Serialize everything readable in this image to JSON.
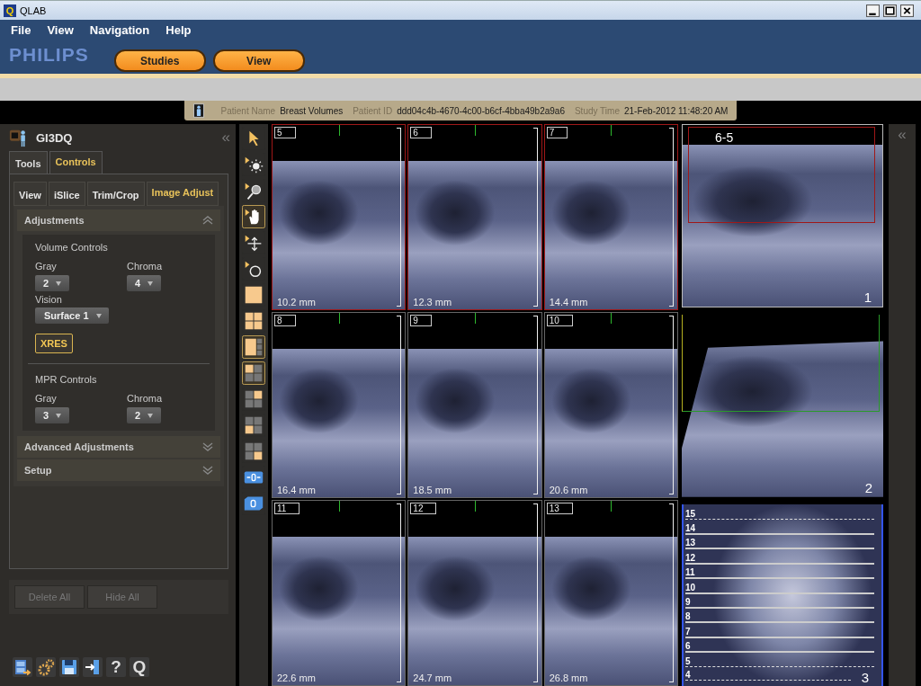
{
  "window": {
    "app_glyph": "Q",
    "title": "QLAB"
  },
  "menu": [
    "File",
    "View",
    "Navigation",
    "Help"
  ],
  "brand": "PHILIPS",
  "nav_tabs": [
    {
      "label": "Studies"
    },
    {
      "label": "View"
    }
  ],
  "patient_bar": {
    "name_label": "Patient Name",
    "name": "Breast Volumes",
    "id_label": "Patient ID",
    "id": "ddd04c4b-4670-4c00-b6cf-4bba49b2a9a6",
    "time_label": "Study Time",
    "time": "21-Feb-2012 11:48:20 AM"
  },
  "left_panel": {
    "title": "GI3DQ",
    "collapse": "«",
    "tabs": [
      {
        "label": "Tools",
        "selected": false
      },
      {
        "label": "Controls",
        "selected": true
      }
    ],
    "subtabs": [
      {
        "label": "View",
        "selected": false
      },
      {
        "label": "iSlice",
        "selected": false
      },
      {
        "label": "Trim/Crop",
        "selected": false
      },
      {
        "label": "Image Adjust",
        "selected": true
      }
    ],
    "sections": [
      {
        "title": "Adjustments",
        "expanded": true
      },
      {
        "title": "Advanced Adjustments",
        "expanded": false
      },
      {
        "title": "Setup",
        "expanded": false
      }
    ],
    "volume_controls": {
      "title": "Volume Controls",
      "dropdowns": [
        {
          "label": "Gray",
          "value": "2"
        },
        {
          "label": "Chroma",
          "value": "4"
        }
      ],
      "vision": {
        "label": "Vision",
        "value": "Surface 1"
      },
      "button": "XRES"
    },
    "mpr_controls": {
      "title": "MPR Controls",
      "dropdowns": [
        {
          "label": "Gray",
          "value": "3"
        },
        {
          "label": "Chroma",
          "value": "2"
        }
      ]
    },
    "action_buttons": [
      {
        "label": "Delete All",
        "disabled": true
      },
      {
        "label": "Hide All",
        "disabled": true
      }
    ],
    "bottom_icons": [
      {
        "kind": "film"
      },
      {
        "kind": "gears"
      },
      {
        "kind": "save"
      },
      {
        "kind": "exit"
      },
      {
        "kind": "help",
        "glyph": "?"
      },
      {
        "kind": "logo",
        "glyph": "Q"
      }
    ]
  },
  "toolbar": [
    {
      "kind": "pointer",
      "selected": false
    },
    {
      "kind": "brightness",
      "selected": false
    },
    {
      "kind": "zoom",
      "selected": false
    },
    {
      "kind": "hand",
      "selected": true
    },
    {
      "kind": "move",
      "selected": false
    },
    {
      "kind": "rotate",
      "selected": false
    },
    {
      "kind": "layout-single",
      "selected": false
    },
    {
      "kind": "layout-quad",
      "selected": false
    },
    {
      "kind": "layout-one-three",
      "selected": true
    },
    {
      "kind": "quad-tl",
      "selected": true
    },
    {
      "kind": "quad-tr",
      "selected": false
    },
    {
      "kind": "quad-bl",
      "selected": false
    },
    {
      "kind": "quad-br",
      "selected": false
    },
    {
      "kind": "slice-offset",
      "selected": false
    },
    {
      "kind": "volume-offset",
      "selected": false
    }
  ],
  "slices": [
    {
      "number": "5",
      "distance": "10.2 mm",
      "selected": true
    },
    {
      "number": "6",
      "distance": "12.3 mm",
      "selected": true
    },
    {
      "number": "7",
      "distance": "14.4 mm",
      "selected": true
    },
    {
      "number": "8",
      "distance": "16.4 mm",
      "selected": false
    },
    {
      "number": "9",
      "distance": "18.5 mm",
      "selected": false
    },
    {
      "number": "10",
      "distance": "20.6 mm",
      "selected": false
    },
    {
      "number": "11",
      "distance": "22.6 mm",
      "selected": false
    },
    {
      "number": "12",
      "distance": "24.7 mm",
      "selected": false
    },
    {
      "number": "13",
      "distance": "26.8 mm",
      "selected": false
    }
  ],
  "views": [
    {
      "kind": "axial",
      "number": "1",
      "label": "6-5"
    },
    {
      "kind": "sagittal",
      "number": "2"
    },
    {
      "kind": "slab",
      "number": "3"
    }
  ],
  "slice_lines": [
    {
      "label": "15",
      "kind": "dashed"
    },
    {
      "label": "14",
      "kind": "solid"
    },
    {
      "label": "13",
      "kind": "solid"
    },
    {
      "label": "12",
      "kind": "solid"
    },
    {
      "label": "11",
      "kind": "solid"
    },
    {
      "label": "10",
      "kind": "solid"
    },
    {
      "label": "9",
      "kind": "solid"
    },
    {
      "label": "8",
      "kind": "solid"
    },
    {
      "label": "7",
      "kind": "solid"
    },
    {
      "label": "6",
      "kind": "solid"
    },
    {
      "label": "5",
      "kind": "dashed"
    },
    {
      "label": "4",
      "kind": "dashed"
    }
  ],
  "right_panel": {
    "collapse": "«"
  }
}
